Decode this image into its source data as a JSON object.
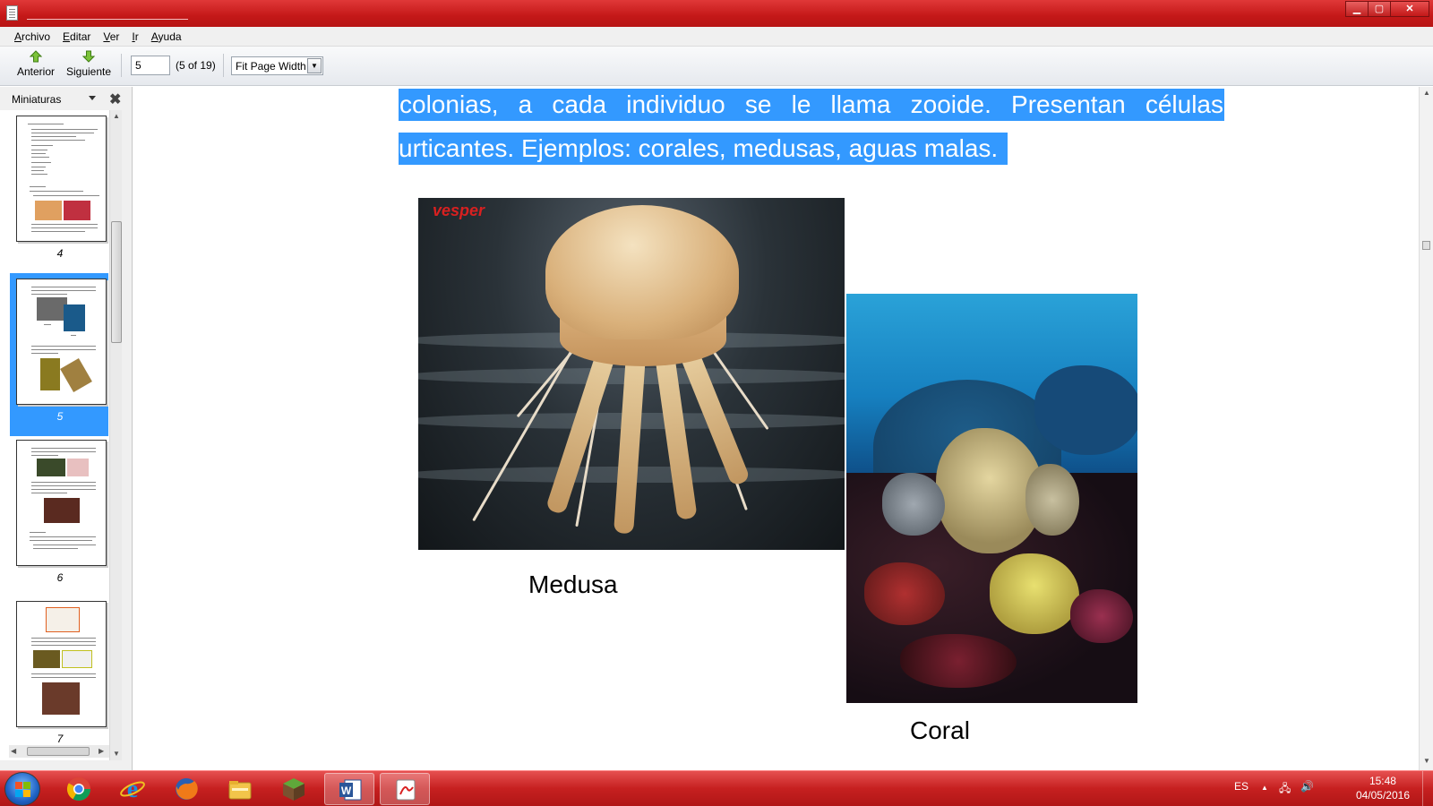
{
  "window": {
    "title": "",
    "controls": {
      "minimize": "▁",
      "maximize": "▢",
      "close": "✕"
    }
  },
  "menu": [
    {
      "label": "Archivo",
      "accel": "A",
      "rest": "rchivo"
    },
    {
      "label": "Editar",
      "accel": "E",
      "rest": "ditar"
    },
    {
      "label": "Ver",
      "accel": "V",
      "rest": "er"
    },
    {
      "label": "Ir",
      "accel": "I",
      "rest": "r"
    },
    {
      "label": "Ayuda",
      "accel": "A",
      "rest": "yuda"
    }
  ],
  "toolbar": {
    "prev_label": "Anterior",
    "next_label": "Siguiente",
    "page_value": "5",
    "page_count": "(5 of 19)",
    "zoom_value": "Fit Page Width",
    "zoom_arrow": "▼"
  },
  "sidebar": {
    "title": "Miniaturas",
    "close": "✖",
    "thumbnails": [
      {
        "label": "4",
        "selected": false
      },
      {
        "label": "5",
        "selected": true
      },
      {
        "label": "6",
        "selected": false
      },
      {
        "label": "7",
        "selected": false
      }
    ]
  },
  "document": {
    "line1": "colonias, a cada individuo se le llama zooide. Presentan células",
    "line2": "urticantes. Ejemplos: corales, medusas, aguas malas.",
    "image1_watermark": "vesper",
    "caption1": "Medusa",
    "caption2": "Coral"
  },
  "taskbar": {
    "apps": [
      "chrome-icon",
      "internet-explorer-icon",
      "firefox-icon",
      "file-explorer-icon",
      "minecraft-icon",
      "word-icon",
      "pdf-reader-icon"
    ],
    "language": "ES",
    "tray_arrow": "▲",
    "network": "🖧",
    "volume": "🔊",
    "time": "15:48",
    "date": "04/05/2016"
  }
}
